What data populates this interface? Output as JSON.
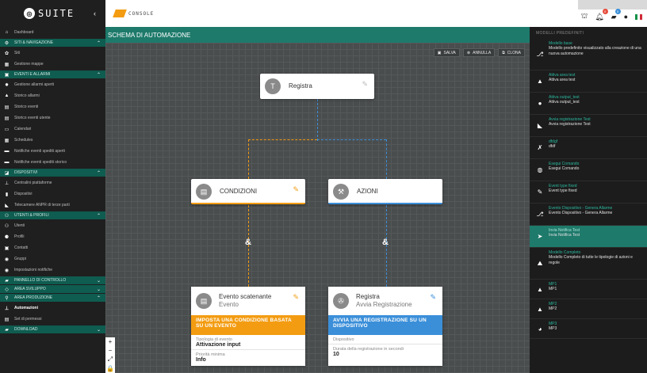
{
  "brand": {
    "name": "SUITE",
    "app": "CONSOLE"
  },
  "topbar": {
    "icons": [
      "briefcase-icon",
      "bell-icon",
      "message-icon",
      "user-icon",
      "italy-flag-icon"
    ],
    "bell_badge": "0",
    "message_badge": "0",
    "badge_colors": {
      "bell": "#e74c3c",
      "message": "#3b8fd9"
    }
  },
  "sidebar": {
    "dashboard": "Dashboard",
    "sections": [
      {
        "title": "SITI & NAVIGAZIONE",
        "items": [
          "Siti",
          "Gestione mappe"
        ]
      },
      {
        "title": "EVENTI E ALLARMI",
        "items": [
          "Gestione allarmi aperti",
          "Storico allarmi",
          "Storico eventi",
          "Storico eventi utente",
          "Calendari",
          "Schedules",
          "Notifiche eventi spediti aperti",
          "Notifiche eventi spediti storico"
        ]
      },
      {
        "title": "DISPOSITIVI",
        "items": [
          "Centralini piattaforme",
          "Dispositivi",
          "Telecamere ANPR di terze parti"
        ]
      },
      {
        "title": "UTENTI & PROFILI",
        "items": [
          "Utenti",
          "Profili",
          "Contatti",
          "Gruppi",
          "Impostazioni notifiche"
        ]
      },
      {
        "title": "PANNELLO DI CONTROLLO",
        "items": []
      },
      {
        "title": "AREA SVILUPPO",
        "items": []
      },
      {
        "title": "AREA PRODUZIONE",
        "items": [
          "Automazioni",
          "Set di permessi"
        ]
      },
      {
        "title": "DOWNLOAD",
        "items": []
      }
    ],
    "active_item": "Automazioni"
  },
  "main": {
    "title": "SCHEMA DI AUTOMAZIONE",
    "toolbar": {
      "save": "SALVA",
      "cancel": "ANNULLA",
      "clone": "CLONA"
    },
    "root_node": {
      "letter": "T",
      "label": "Registra"
    },
    "conditions_node": {
      "label": "CONDIZIONI"
    },
    "actions_node": {
      "label": "AZIONI"
    },
    "and_symbol": "&",
    "trigger_card": {
      "title": "Evento scatenante",
      "subtitle": "Evento",
      "band": "IMPOSTA UNA CONDIZIONE BASATA SU UN EVENTO",
      "fields": [
        {
          "label": "Tipologia di evento",
          "value": "Attivazione input"
        },
        {
          "label": "Priorità minima",
          "value": "Info"
        }
      ]
    },
    "action_card": {
      "title": "Registra",
      "subtitle": "Avvia Registrazione",
      "band": "AVVIA UNA REGISTRAZIONE SU UN DISPOSITIVO",
      "fields": [
        {
          "label": "Dispositivo",
          "value": ""
        },
        {
          "label": "Durata della registrazione in secondi",
          "value": "10"
        }
      ]
    },
    "zoom_controls": [
      "+",
      "−",
      "⤢",
      "🔒"
    ],
    "colors": {
      "trigger": "#f39c12",
      "action": "#3b8fd9",
      "accent": "#1e7a6b"
    }
  },
  "right_panel": {
    "title": "MODELLI PREDEFINITI",
    "items": [
      {
        "icon": "flow-icon",
        "name": "Modello base",
        "desc": "Modello predefinito visualizzato alla creazione di una nuova automazione"
      },
      {
        "icon": "bell-icon",
        "name": "Attiva area test",
        "desc": "Attiva area test"
      },
      {
        "icon": "bulb-icon",
        "name": "Attiva output_test",
        "desc": "Attiva output_test"
      },
      {
        "icon": "megaphone-icon",
        "name": "Avvia registrazione Test",
        "desc": "Avvia registrazione Test"
      },
      {
        "icon": "tools-icon",
        "name": "dfdgf",
        "desc": "dfdf"
      },
      {
        "icon": "command-icon",
        "name": "Esegui Comando",
        "desc": "Esegui Comando"
      },
      {
        "icon": "pencil-icon",
        "name": "Event type fixed",
        "desc": "Event type fixed"
      },
      {
        "icon": "flow-icon",
        "name": "Evento Dispositivo - Genera Allarme",
        "desc": "Evento Dispositivo - Genera Allarme"
      },
      {
        "icon": "send-icon",
        "name": "Invia Notifica Test",
        "desc": "Invia Notifica Test"
      },
      {
        "icon": "complete-icon",
        "name": "Modello Completo",
        "desc": "Modello Completo di tutte le tipologie di azioni e regole"
      },
      {
        "icon": "mp-icon",
        "name": "MP1",
        "desc": "MP1"
      },
      {
        "icon": "mp-icon",
        "name": "MP2",
        "desc": "MP2"
      },
      {
        "icon": "mp3-icon",
        "name": "MP3",
        "desc": "MP3"
      }
    ],
    "active_index": 8
  }
}
